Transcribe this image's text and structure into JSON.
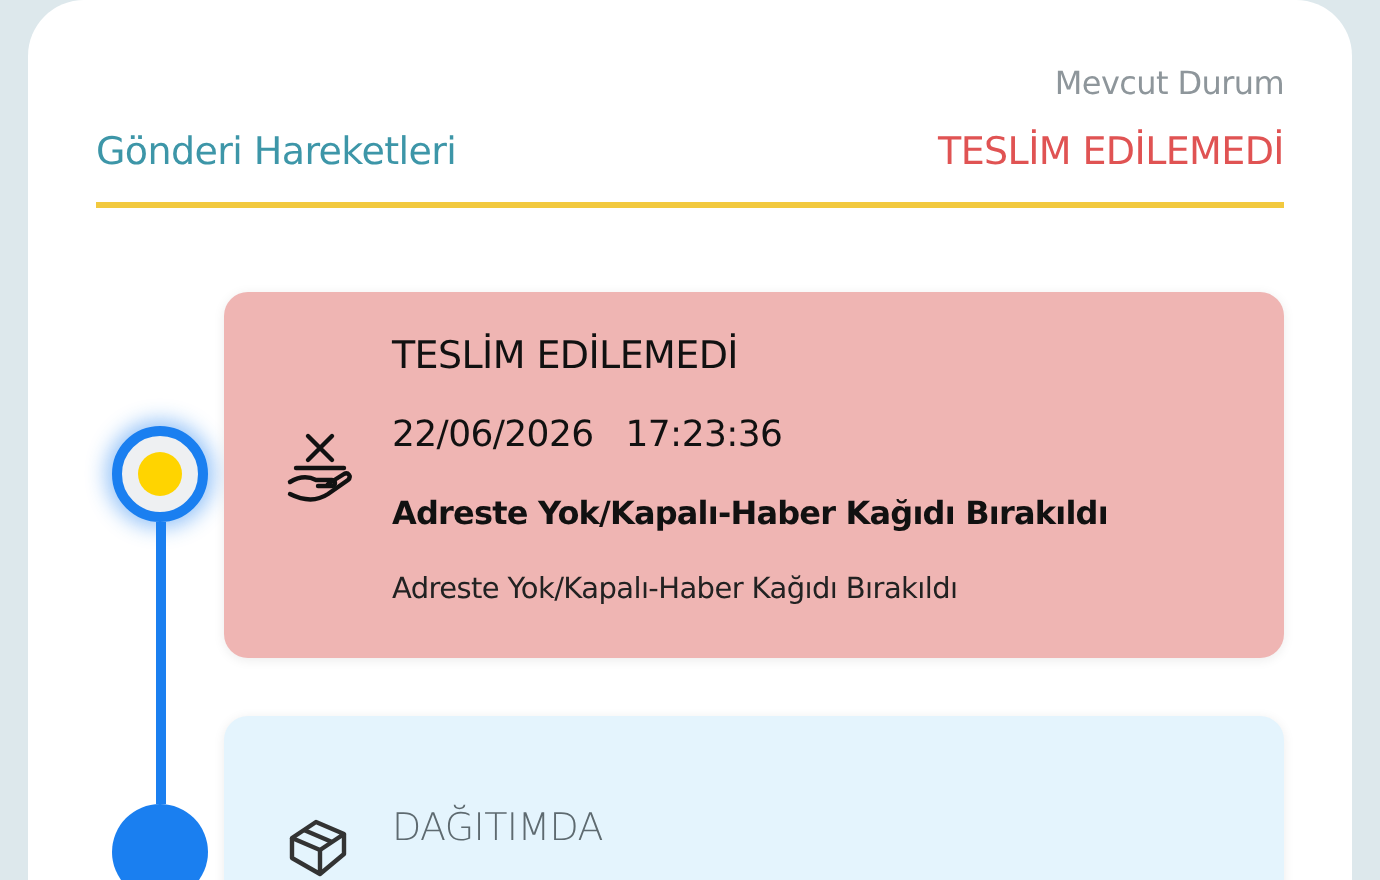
{
  "header": {
    "title": "Gönderi Hareketleri",
    "status_label": "Mevcut Durum",
    "status_value": "TESLİM EDİLEMEDİ"
  },
  "events": [
    {
      "kind": "undelivered",
      "selected": true,
      "title": "TESLİM EDİLEMEDİ",
      "date": "22/06/2026",
      "time": "17:23:36",
      "reason": "Adreste Yok/Kapalı-Haber Kağıdı Bırakıldı",
      "detail": "Adreste Yok/Kapalı-Haber Kağıdı Bırakıldı"
    },
    {
      "kind": "out_for_delivery",
      "selected": false,
      "title": "DAĞITIMDA"
    }
  ]
}
